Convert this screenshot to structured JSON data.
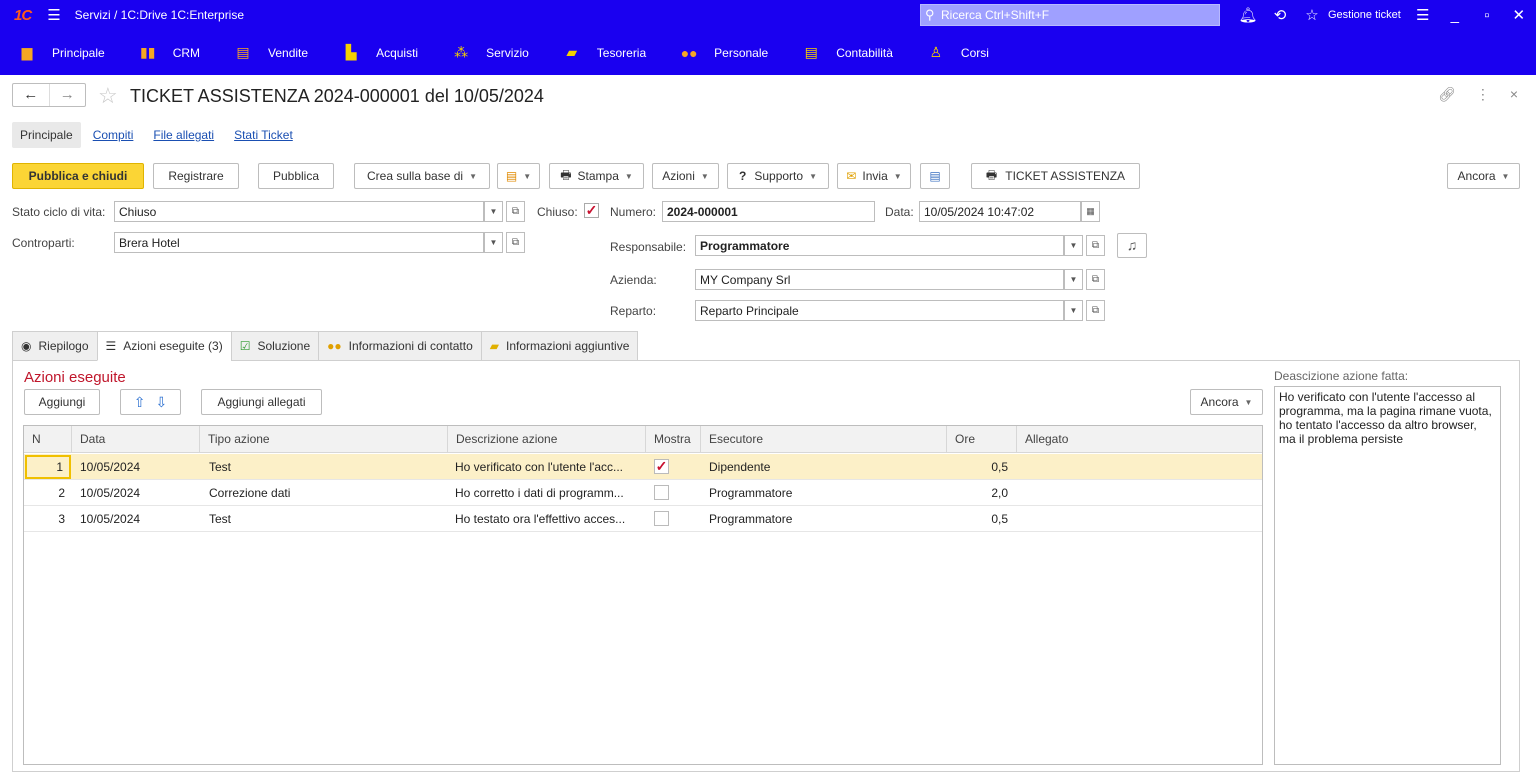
{
  "titlebar": {
    "logo": "1C",
    "app_title": "Servizi / 1C:Drive 1C:Enterprise",
    "search_placeholder": "Ricerca Ctrl+Shift+F",
    "user": "Gestione ticket"
  },
  "sections": [
    {
      "label": "Principale",
      "icon": "home-icon",
      "color": "#f5a623"
    },
    {
      "label": "CRM",
      "icon": "crm-icon",
      "color": "#f5a623"
    },
    {
      "label": "Vendite",
      "icon": "sales-icon",
      "color": "#f5a623"
    },
    {
      "label": "Acquisti",
      "icon": "truck-icon",
      "color": "#f5d000"
    },
    {
      "label": "Servizio",
      "icon": "service-icon",
      "color": "#f5d000"
    },
    {
      "label": "Tesoreria",
      "icon": "treasury-icon",
      "color": "#f5d000"
    },
    {
      "label": "Personale",
      "icon": "people-icon",
      "color": "#f5a623"
    },
    {
      "label": "Contabilità",
      "icon": "accounting-icon",
      "color": "#f5d000"
    },
    {
      "label": "Corsi",
      "icon": "courses-icon",
      "color": "#f5d000"
    }
  ],
  "form": {
    "title": "TICKET ASSISTENZA 2024-000001 del 10/05/2024",
    "tabs": [
      "Principale",
      "Compiti",
      "File allegati",
      "Stati Ticket"
    ]
  },
  "commands": {
    "publish_close": "Pubblica e chiudi",
    "register": "Registrare",
    "publish": "Pubblica",
    "create_based": "Crea sulla base di",
    "print": "Stampa",
    "actions": "Azioni",
    "support_q": "?",
    "support": "Supporto",
    "send": "Invia",
    "ticket_print": "TICKET ASSISTENZA",
    "more": "Ancora"
  },
  "fields": {
    "lifecycle_label": "Stato ciclo di vita:",
    "lifecycle_value": "Chiuso",
    "closed_label": "Chiuso:",
    "closed_checked": true,
    "number_label": "Numero:",
    "number_value": "2024-000001",
    "date_label": "Data:",
    "date_value": "10/05/2024 10:47:02",
    "counterparty_label": "Controparti:",
    "counterparty_value": "Brera Hotel",
    "responsible_label": "Responsabile:",
    "responsible_value": "Programmatore",
    "company_label": "Azienda:",
    "company_value": "MY Company Srl",
    "department_label": "Reparto:",
    "department_value": "Reparto Principale"
  },
  "detail_tabs": [
    {
      "label": "Riepilogo",
      "icon": "eye-icon"
    },
    {
      "label": "Azioni eseguite (3)",
      "icon": "list-icon"
    },
    {
      "label": "Soluzione",
      "icon": "checkbox-icon"
    },
    {
      "label": "Informazioni di contatto",
      "icon": "contacts-icon"
    },
    {
      "label": "Informazioni aggiuntive",
      "icon": "folder-gear-icon"
    }
  ],
  "actions_section": {
    "title": "Azioni eseguite",
    "add": "Aggiungi",
    "add_attachments": "Aggiungi allegati",
    "more": "Ancora",
    "columns": [
      "N",
      "Data",
      "Tipo azione",
      "Descrizione azione",
      "Mostra",
      "Esecutore",
      "Ore",
      "Allegato"
    ],
    "rows": [
      {
        "n": "1",
        "date": "10/05/2024",
        "type": "Test",
        "desc": "Ho verificato con l'utente l'acc...",
        "show": true,
        "executor": "Dipendente",
        "hours": "0,5",
        "attachment": ""
      },
      {
        "n": "2",
        "date": "10/05/2024",
        "type": "Correzione dati",
        "desc": "Ho corretto i dati di programm...",
        "show": false,
        "executor": "Programmatore",
        "hours": "2,0",
        "attachment": ""
      },
      {
        "n": "3",
        "date": "10/05/2024",
        "type": "Test",
        "desc": "Ho testato ora l'effettivo acces...",
        "show": false,
        "executor": "Programmatore",
        "hours": "0,5",
        "attachment": ""
      }
    ],
    "description_label": "Deascizione azione fatta:",
    "description_text": "Ho verificato con l'utente l'accesso al programma, ma la pagina rimane vuota, ho tentato l'accesso da altro browser, ma il problema persiste"
  }
}
